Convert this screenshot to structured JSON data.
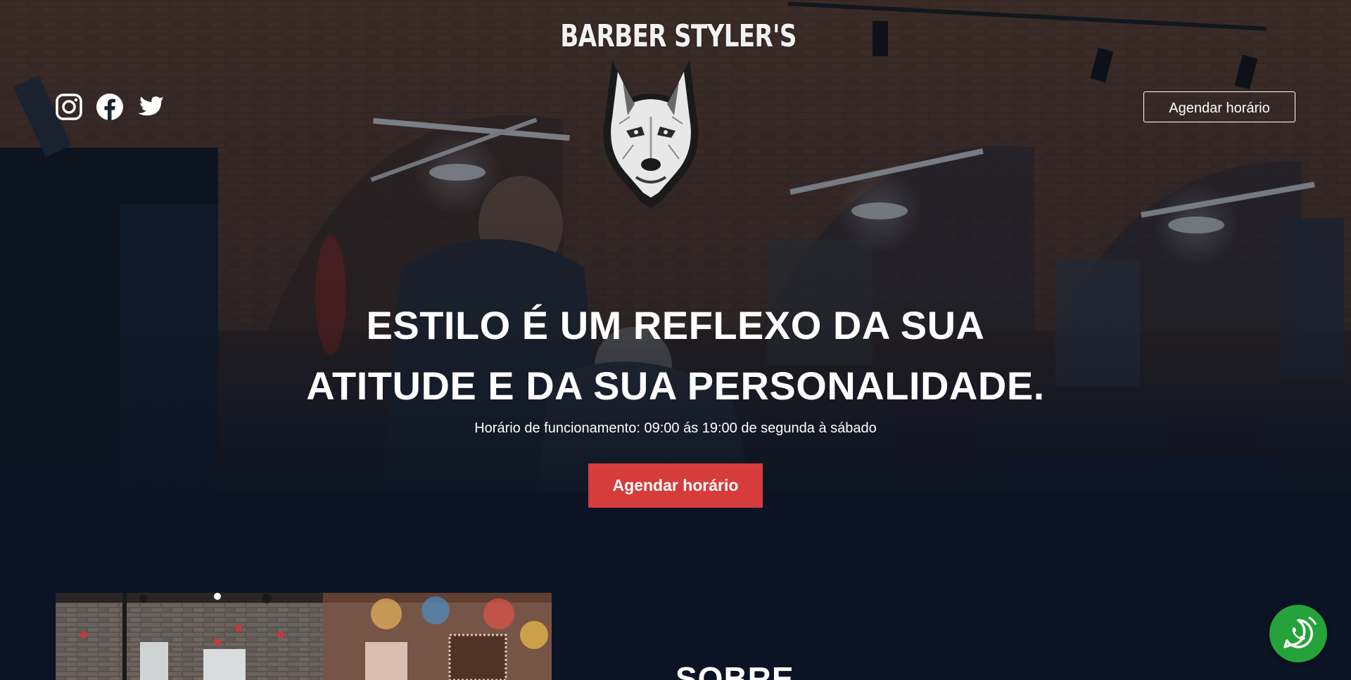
{
  "brand": {
    "name": "BARBER STYLER'S"
  },
  "header": {
    "social": [
      {
        "name": "instagram-icon"
      },
      {
        "name": "facebook-icon"
      },
      {
        "name": "twitter-icon"
      }
    ],
    "cta_label": "Agendar horário"
  },
  "hero": {
    "headline_line1": "ESTILO É UM REFLEXO DA SUA",
    "headline_line2": "ATITUDE E DA SUA PERSONALIDADE.",
    "hours": "Horário de funcionamento: 09:00 ás 19:00 de segunda à sábado",
    "cta_label": "Agendar horário"
  },
  "about": {
    "title": "SOBRE"
  },
  "colors": {
    "background": "#0b1424",
    "accent": "#d63c3c",
    "whatsapp": "#25a23a"
  },
  "floating": {
    "icon": "whatsapp-icon"
  }
}
